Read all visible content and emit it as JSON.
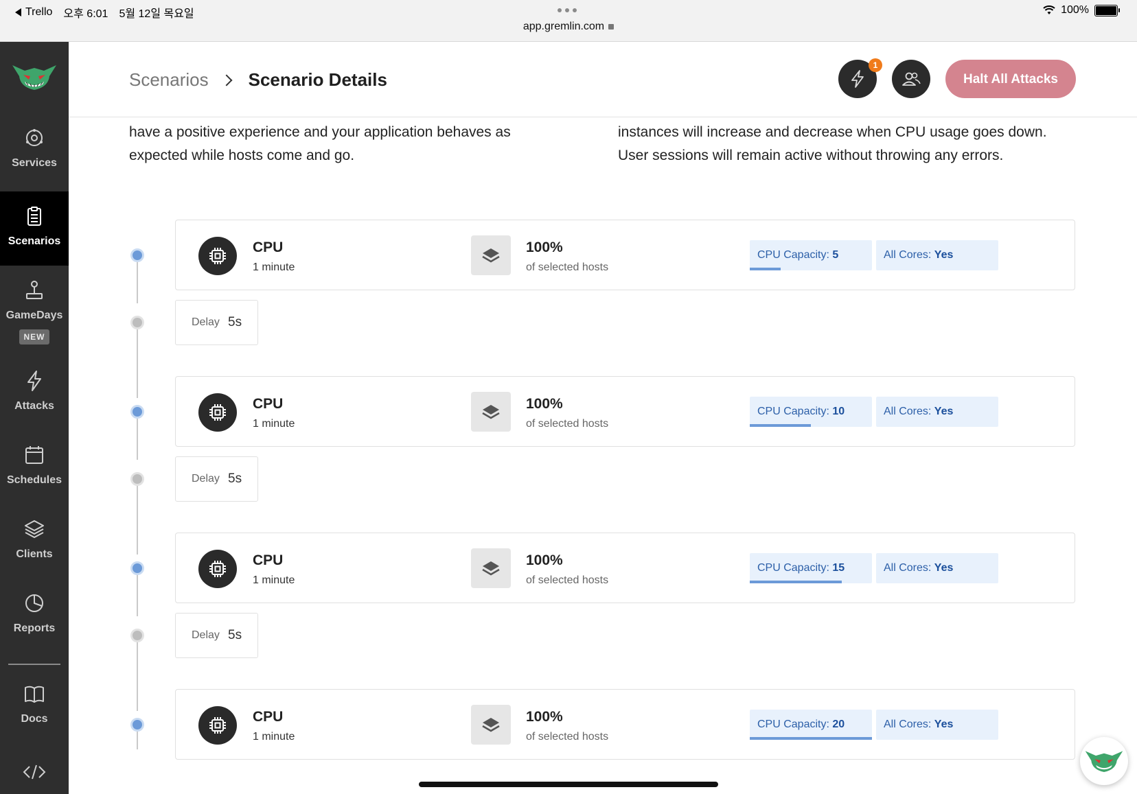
{
  "status_bar": {
    "back_app": "Trello",
    "time": "오후 6:01",
    "date": "5월 12일 목요일",
    "url": "app.gremlin.com",
    "battery": "100%"
  },
  "sidebar": {
    "items": [
      {
        "label": "Services",
        "icon": "services-icon"
      },
      {
        "label": "Scenarios",
        "icon": "clipboard-icon",
        "active": true
      },
      {
        "label": "GameDays",
        "icon": "joystick-icon",
        "badge": "NEW"
      },
      {
        "label": "Attacks",
        "icon": "lightning-icon"
      },
      {
        "label": "Schedules",
        "icon": "calendar-icon"
      },
      {
        "label": "Clients",
        "icon": "layers-icon"
      },
      {
        "label": "Reports",
        "icon": "pie-chart-icon"
      },
      {
        "label": "Docs",
        "icon": "book-icon"
      }
    ],
    "code_icon": "code-icon"
  },
  "header": {
    "breadcrumb_parent": "Scenarios",
    "breadcrumb_current": "Scenario Details",
    "notification_count": "1",
    "halt_label": "Halt All Attacks"
  },
  "description": {
    "left_lines": [
      "have a positive experience and your application behaves as",
      "expected while hosts come and go."
    ],
    "right_lines": [
      "instances will increase and decrease when CPU usage goes down.",
      "User sessions will remain active without throwing any errors."
    ]
  },
  "steps": [
    {
      "title": "CPU",
      "duration": "1 minute",
      "percent": "100%",
      "percent_label": "of selected hosts",
      "capacity_label": "CPU Capacity: ",
      "capacity_value": "5",
      "capacity_fraction": 0.25,
      "cores_label": "All Cores: ",
      "cores_value": "Yes"
    },
    {
      "title": "CPU",
      "duration": "1 minute",
      "percent": "100%",
      "percent_label": "of selected hosts",
      "capacity_label": "CPU Capacity: ",
      "capacity_value": "10",
      "capacity_fraction": 0.5,
      "cores_label": "All Cores: ",
      "cores_value": "Yes"
    },
    {
      "title": "CPU",
      "duration": "1 minute",
      "percent": "100%",
      "percent_label": "of selected hosts",
      "capacity_label": "CPU Capacity: ",
      "capacity_value": "15",
      "capacity_fraction": 0.75,
      "cores_label": "All Cores: ",
      "cores_value": "Yes"
    },
    {
      "title": "CPU",
      "duration": "1 minute",
      "percent": "100%",
      "percent_label": "of selected hosts",
      "capacity_label": "CPU Capacity: ",
      "capacity_value": "20",
      "capacity_fraction": 1.0,
      "cores_label": "All Cores: ",
      "cores_value": "Yes"
    }
  ],
  "delays": [
    {
      "label": "Delay",
      "value": "5s"
    },
    {
      "label": "Delay",
      "value": "5s"
    },
    {
      "label": "Delay",
      "value": "5s"
    }
  ],
  "colors": {
    "sidebar_bg": "#2e2e2e",
    "halt_button": "#d4848f",
    "accent_blue": "#6c9ad8",
    "tag_bg": "#e8f1fc",
    "notification": "#f07b1a"
  }
}
